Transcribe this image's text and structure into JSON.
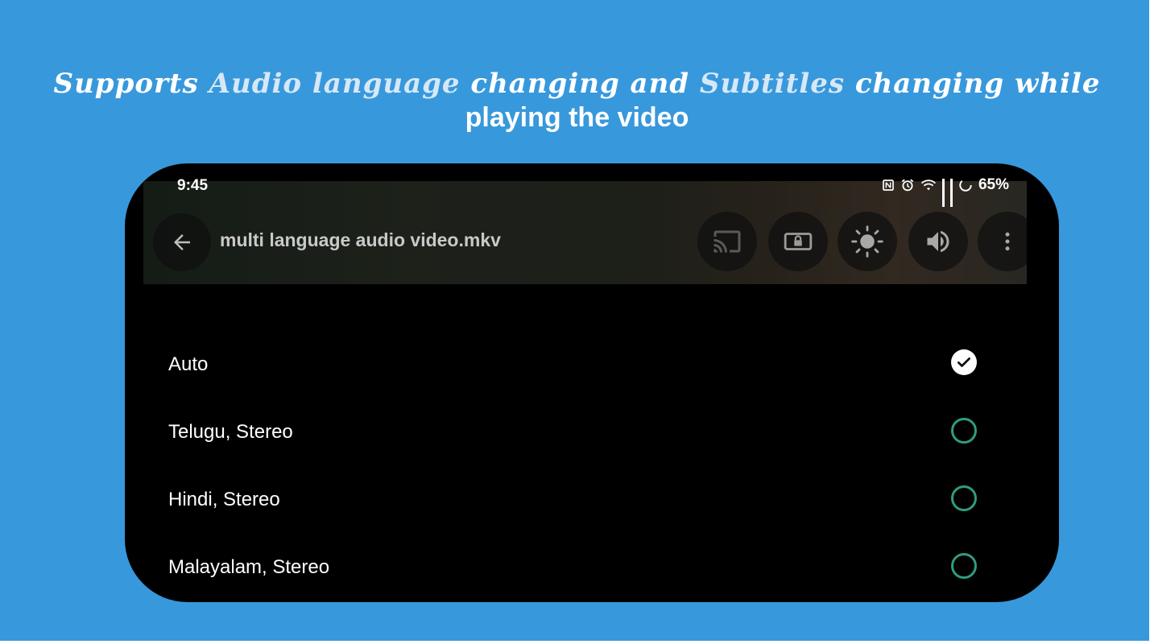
{
  "banner": {
    "line1_prefix": "Supports ",
    "line1_hl1": "Audio language",
    "line1_mid": " changing and ",
    "line1_hl2": "Subtitles",
    "line1_suffix": " changing while",
    "line2": "playing the video"
  },
  "status_bar": {
    "time": "9:45",
    "battery_percent": "65%",
    "icons": [
      "nfc-icon",
      "alarm-icon",
      "wifi-icon",
      "cellular-signal-icon",
      "cellular-signal-icon",
      "battery-icon"
    ]
  },
  "player_header": {
    "file_name": "multi language audio video.mkv",
    "buttons": [
      "cast-icon",
      "lock-screen-icon",
      "brightness-icon",
      "volume-icon",
      "more-vert-icon"
    ]
  },
  "audio_tracks": [
    {
      "label": "Auto",
      "selected": true
    },
    {
      "label": "Telugu, Stereo",
      "selected": false
    },
    {
      "label": "Hindi, Stereo",
      "selected": false
    },
    {
      "label": "Malayalam, Stereo",
      "selected": false
    }
  ],
  "colors": {
    "background": "#3898dc",
    "radio_accent": "#2e9c80",
    "phone": "#000000"
  }
}
